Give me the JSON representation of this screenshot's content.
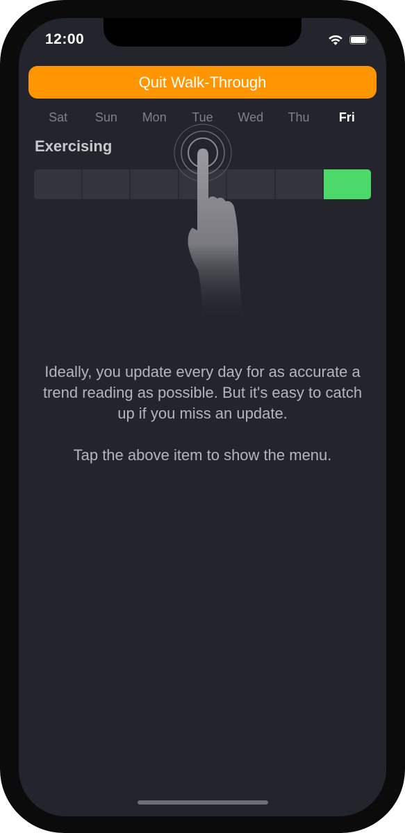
{
  "status_bar": {
    "time": "12:00",
    "icons": [
      "wifi-icon",
      "battery-icon"
    ]
  },
  "walkthrough": {
    "quit_label": "Quit Walk-Through"
  },
  "days": [
    "Sat",
    "Sun",
    "Mon",
    "Tue",
    "Wed",
    "Thu",
    "Fri"
  ],
  "selected_day": "Fri",
  "habit": {
    "name": "Exercising",
    "completed_days": [
      "Fri"
    ]
  },
  "hint_icon": "tap-finger-icon",
  "message": {
    "line1": "Ideally, you update every day for as accurate a trend reading as possible. But it's easy to catch up if you miss an update.",
    "line2": "Tap the above item to show the menu."
  },
  "colors": {
    "accent": "#ff9500",
    "complete": "#4cd96a",
    "background": "#24252c"
  }
}
